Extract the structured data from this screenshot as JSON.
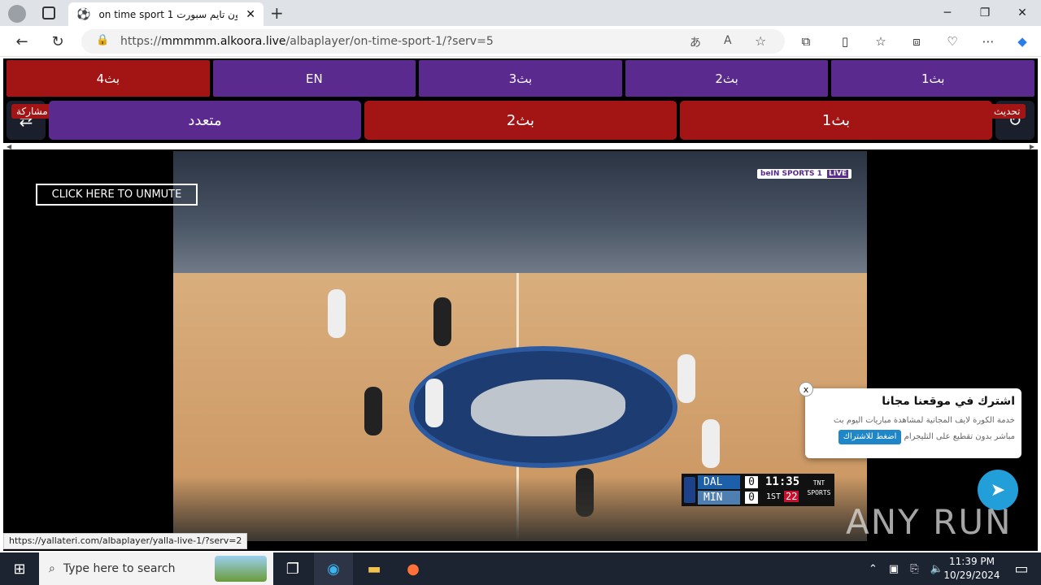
{
  "browser": {
    "tab_title": "on time sport 1 اون تايم سبورت",
    "url_prefix": "https://",
    "url_host": "mmmmm.alkoora.live",
    "url_path": "/albaplayer/on-time-sport-1/?serv=5"
  },
  "servers_row1": [
    "بث4",
    "EN",
    "بث3",
    "بث2",
    "بث1"
  ],
  "servers_row2": [
    "متعدد",
    "بث2",
    "بث1"
  ],
  "side": {
    "share_label": "مشاركة",
    "refresh_label": "تحديث"
  },
  "player": {
    "unmute_label": "CLICK HERE TO UNMUTE",
    "channel_badge": "beIN SPORTS 1",
    "live_label": "LIVE",
    "score": {
      "team1": "DAL",
      "score1": "0",
      "team2": "MIN",
      "score2": "0",
      "clock": "11:35",
      "period": "1ST",
      "shot_clock": "22",
      "network": "TNT SPORTS"
    }
  },
  "popup": {
    "title": "اشترك في موقعنا مجانا",
    "text": "خدمة الكورة لايف المجانية لمشاهدة مباريات اليوم بث مباشر بدون تقطيع على التليجرام",
    "button": "اضغط للاشتراك",
    "close": "x"
  },
  "watermark": "ANY RUN",
  "status_url": "https://yallateri.com/albaplayer/yalla-live-1/?serv=2",
  "taskbar": {
    "search_placeholder": "Type here to search",
    "time": "11:39 PM",
    "date": "10/29/2024"
  },
  "colors": {
    "purple": "#5b2a8e",
    "red": "#a31515",
    "telegram": "#229ed9"
  }
}
